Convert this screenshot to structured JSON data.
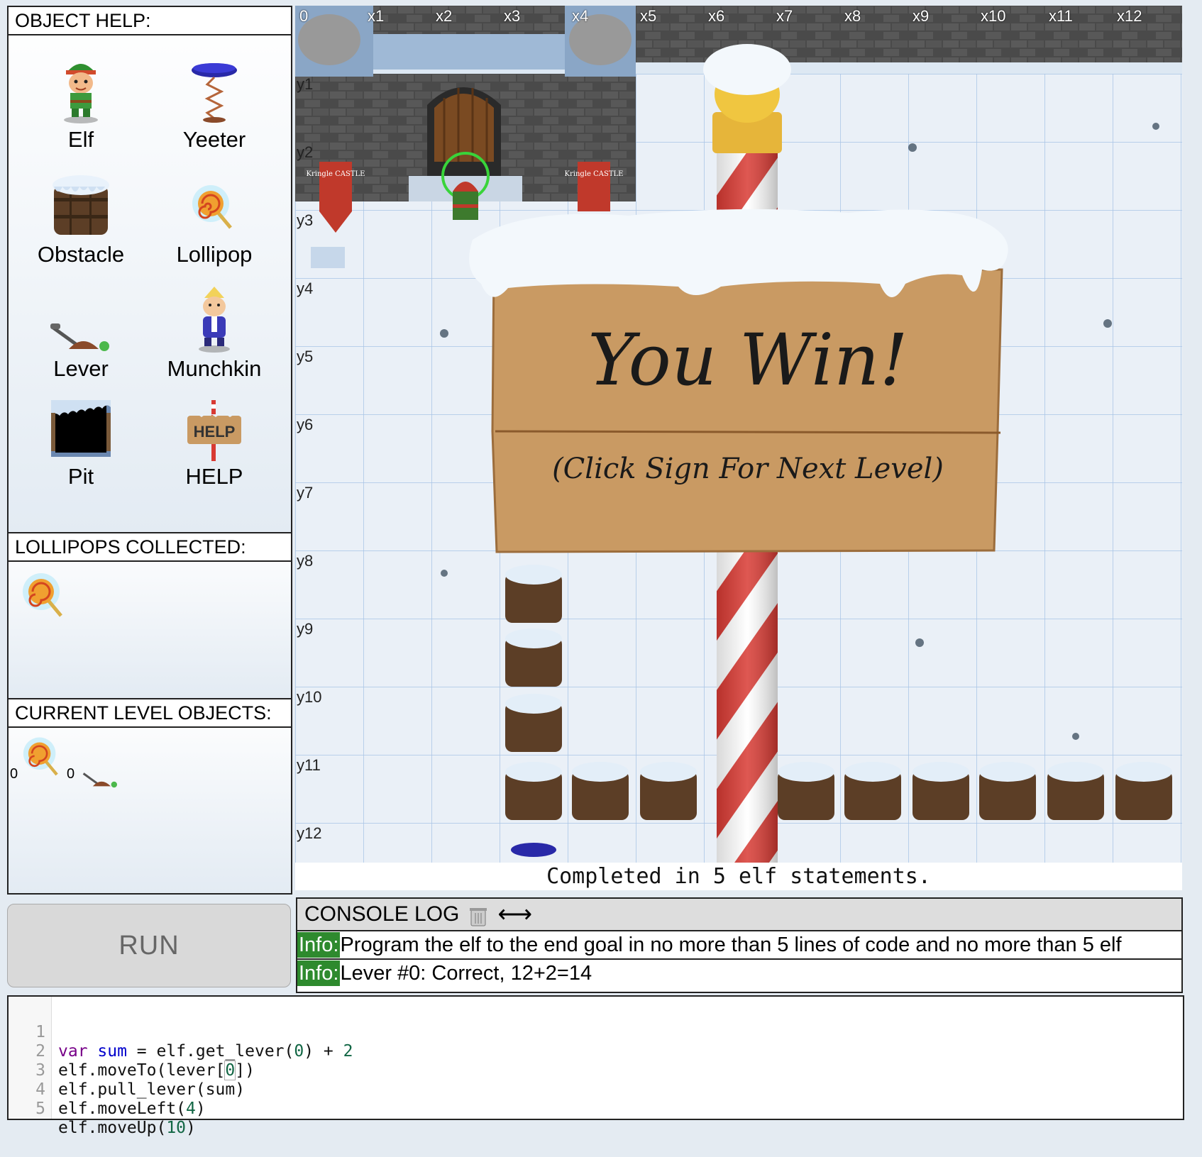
{
  "object_help": {
    "title": "OBJECT HELP:",
    "items": [
      {
        "label": "Elf",
        "icon": "elf-icon"
      },
      {
        "label": "Yeeter",
        "icon": "yeeter-icon"
      },
      {
        "label": "Obstacle",
        "icon": "obstacle-icon"
      },
      {
        "label": "Lollipop",
        "icon": "lollipop-icon"
      },
      {
        "label": "Lever",
        "icon": "lever-icon"
      },
      {
        "label": "Munchkin",
        "icon": "munchkin-icon"
      },
      {
        "label": "Pit",
        "icon": "pit-icon"
      },
      {
        "label": "HELP",
        "icon": "help-sign-icon",
        "sign_text": "HELP"
      }
    ]
  },
  "lollipops_collected": {
    "title": "LOLLIPOPS COLLECTED:"
  },
  "current_level_objects": {
    "title": "CURRENT LEVEL OBJECTS:",
    "lollipop_index": "0",
    "lever_index": "0"
  },
  "grid": {
    "x_labels": [
      "0",
      "x1",
      "x2",
      "x3",
      "x4",
      "x5",
      "x6",
      "x7",
      "x8",
      "x9",
      "x10",
      "x11",
      "x12"
    ],
    "y_labels": [
      "y1",
      "y2",
      "y3",
      "y4",
      "y5",
      "y6",
      "y7",
      "y8",
      "y9",
      "y10",
      "y11",
      "y12"
    ],
    "banner_text": "Kringle CASTLE"
  },
  "win_sign": {
    "title": "You Win!",
    "subtitle": "(Click Sign For Next Level)"
  },
  "status": "Completed in 5 elf statements.",
  "run_button": "RUN",
  "console": {
    "title": "CONSOLE LOG",
    "resize_glyph": "⟷",
    "lines": [
      {
        "tag": "Info:",
        "text": "Program the elf to the end goal in no more than 5 lines of code and no more than 5 elf"
      },
      {
        "tag": "Info:",
        "text": "Lever #0: Correct, 12+2=14"
      }
    ]
  },
  "code": {
    "line_numbers": [
      "1",
      "2",
      "3",
      "4",
      "5"
    ],
    "line1": {
      "kw": "var",
      "var": "sum",
      "a": " = elf.get_lever(",
      "n1": "0",
      "b": ") + ",
      "n2": "2"
    },
    "line2": {
      "a": "elf.moveTo(lever[",
      "n": "0",
      "b": "])"
    },
    "line3": "elf.pull_lever(sum)",
    "line4": {
      "a": "elf.moveLeft(",
      "n": "4",
      "b": ")"
    },
    "line5": {
      "a": "elf.moveUp(",
      "n": "10",
      "b": ")"
    }
  },
  "colors": {
    "accent_green": "#2e8a2e",
    "grid_line": "#a8c4e6",
    "pole_red": "#d83a33",
    "sign_wood": "#c99a63"
  }
}
